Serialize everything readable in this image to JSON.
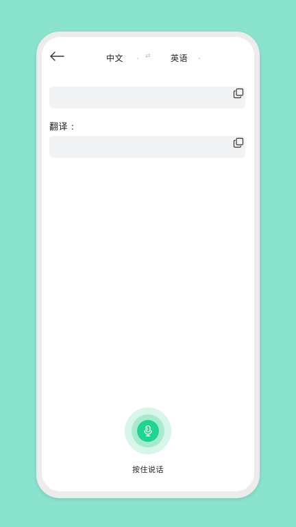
{
  "header": {
    "back_icon": "arrow-left-icon",
    "source_language": "中文",
    "target_language": "英语",
    "chevron_glyph": "⌄",
    "swap_glyph": "⇄"
  },
  "source": {
    "text": "",
    "copy_icon": "copy-icon"
  },
  "translation": {
    "label": "翻译 :",
    "text": "",
    "copy_icon": "copy-icon"
  },
  "voice": {
    "icon": "microphone-icon",
    "label": "按住说话"
  },
  "colors": {
    "background": "#8ae3cd",
    "accent": "#1ed48f",
    "accent_light": "#a8ead0",
    "accent_lighter": "#d7f5e8",
    "field_bg": "#f2f3f5"
  }
}
